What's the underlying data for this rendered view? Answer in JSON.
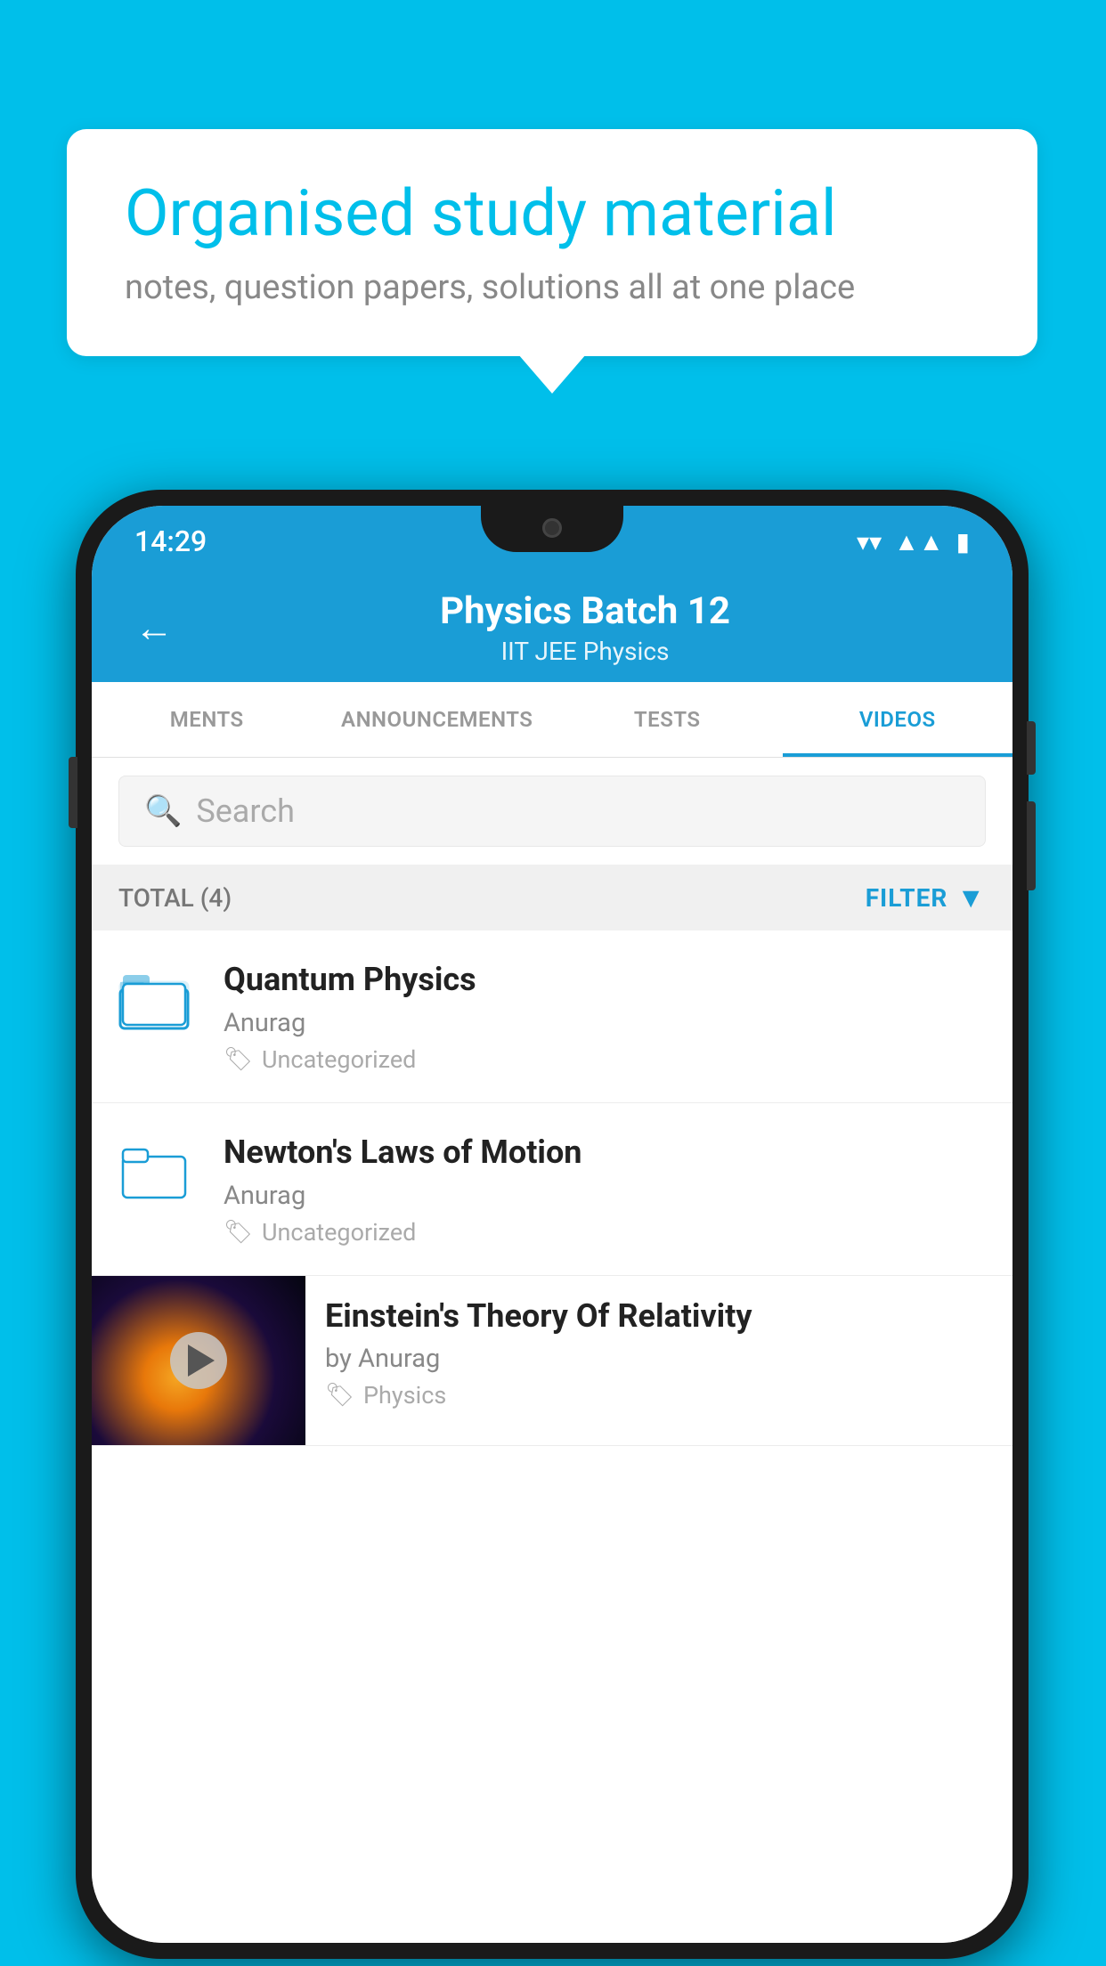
{
  "background_color": "#00BFEA",
  "speech_bubble": {
    "title": "Organised study material",
    "subtitle": "notes, question papers, solutions all at one place"
  },
  "status_bar": {
    "time": "14:29",
    "wifi": "▼",
    "signal": "▲",
    "battery": "▮"
  },
  "header": {
    "title": "Physics Batch 12",
    "subtitle": "IIT JEE   Physics",
    "back_label": "←"
  },
  "tabs": [
    {
      "label": "MENTS",
      "active": false
    },
    {
      "label": "ANNOUNCEMENTS",
      "active": false
    },
    {
      "label": "TESTS",
      "active": false
    },
    {
      "label": "VIDEOS",
      "active": true
    }
  ],
  "search": {
    "placeholder": "Search"
  },
  "filter_row": {
    "total_label": "TOTAL (4)",
    "filter_label": "FILTER"
  },
  "videos": [
    {
      "title": "Quantum Physics",
      "author": "Anurag",
      "tag": "Uncategorized",
      "has_thumbnail": false
    },
    {
      "title": "Newton's Laws of Motion",
      "author": "Anurag",
      "tag": "Uncategorized",
      "has_thumbnail": false
    },
    {
      "title": "Einstein's Theory Of Relativity",
      "author": "by Anurag",
      "tag": "Physics",
      "has_thumbnail": true
    }
  ]
}
